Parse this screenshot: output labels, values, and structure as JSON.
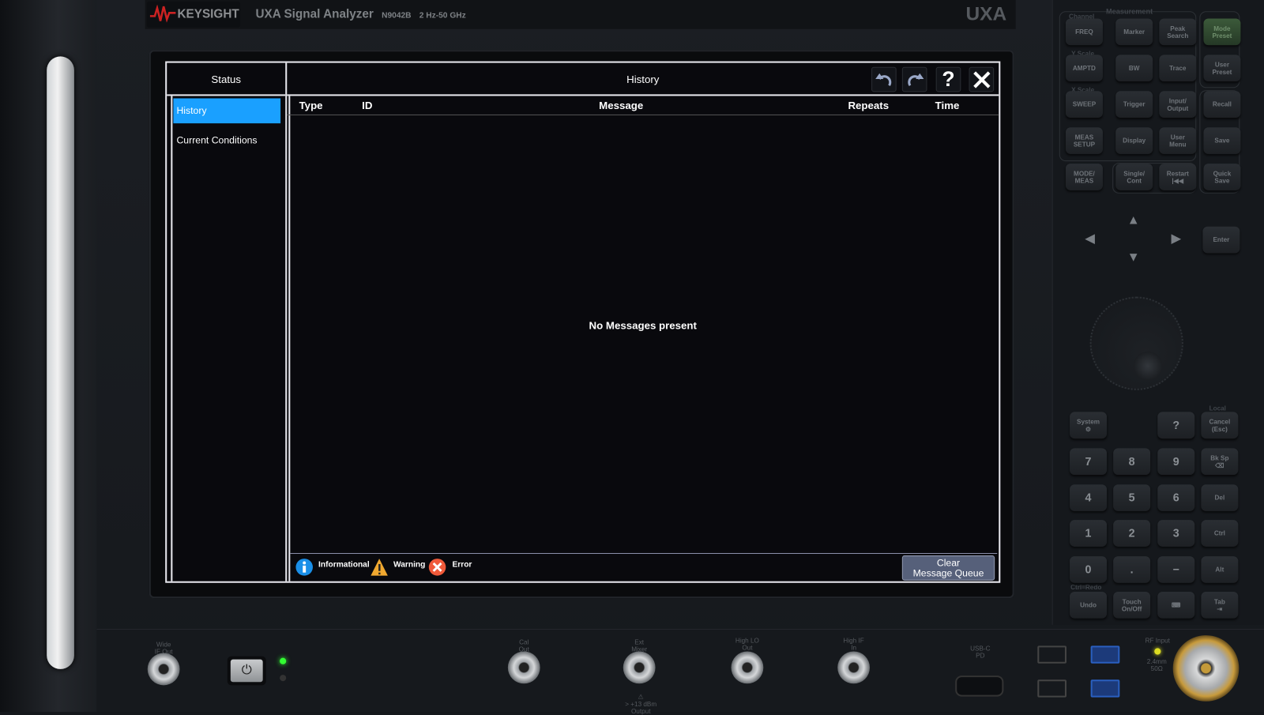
{
  "header": {
    "brand": "KEYSIGHT",
    "product": "UXA Signal Analyzer",
    "model": "N9042B",
    "range": "2 Hz-50 GHz",
    "series_badge": "UXA"
  },
  "dialog": {
    "sidebar": {
      "title": "Status",
      "items": [
        {
          "label": "History",
          "active": true
        },
        {
          "label": "Current Conditions",
          "active": false
        }
      ]
    },
    "title": "History",
    "toolbar": [
      {
        "icon": "undo-icon"
      },
      {
        "icon": "redo-icon"
      },
      {
        "icon": "help-icon",
        "label": "?"
      },
      {
        "icon": "close-icon"
      }
    ],
    "columns": [
      "Type",
      "ID",
      "Message",
      "Repeats",
      "Time"
    ],
    "empty_message": "No Messages present",
    "legend": [
      {
        "icon": "info-icon",
        "label": "Informational",
        "color": "#1a8fe8"
      },
      {
        "icon": "warning-icon",
        "label": "Warning",
        "color": "#f0a830"
      },
      {
        "icon": "error-icon",
        "label": "Error",
        "color": "#f05a3a"
      }
    ],
    "clear_button": "Clear\nMessage Queue",
    "accent": "#1aa0ff"
  },
  "front_panel": {
    "group_labels": {
      "measurement": "Measurement",
      "channel": "Channel",
      "y_scale": "Y Scale",
      "x_scale": "X Scale",
      "local": "Local",
      "ctrl_redo": "Ctrl=Redo"
    },
    "keys": [
      "FREQ",
      "Marker",
      "Peak\nSearch",
      "Mode\nPreset",
      "AMPTD",
      "BW",
      "Trace",
      "User\nPreset",
      "SWEEP",
      "Trigger",
      "Input/\nOutput",
      "Recall",
      "MEAS\nSETUP",
      "Display",
      "User\nMenu",
      "Save",
      "MODE/\nMEAS",
      "Single/\nCont",
      "Restart\n|◀◀",
      "Quick\nSave"
    ],
    "nav_keys": [
      "▲",
      "◀",
      "▶",
      "▼"
    ],
    "enter": "Enter",
    "keypad": [
      "System\n⚙",
      "?",
      "Cancel\n(Esc)",
      "7",
      "8",
      "9",
      "Bk Sp\n⌫",
      "4",
      "5",
      "6",
      "Del",
      "1",
      "2",
      "3",
      "Ctrl",
      "0",
      ".",
      "−",
      "Alt",
      "Undo",
      "Touch\nOn/Off",
      "⌨",
      "Tab\n⇥"
    ],
    "connectors": [
      "Wide\nIF Out",
      "Cal\nOut",
      "Ext\nMixer",
      "High LO\nOut",
      "High IF\nIn",
      "USB-C\nPD",
      "RF Input"
    ],
    "ext_mixer_warning": "> +13 dBm Output",
    "rf_spec": "2.4mm\n50Ω"
  }
}
